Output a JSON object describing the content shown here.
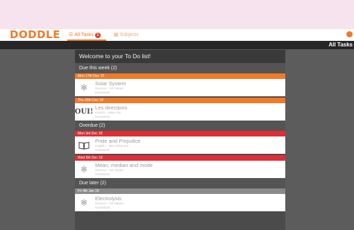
{
  "app": {
    "logo": "DODDLE"
  },
  "nav": {
    "tabs": [
      {
        "label": "All Tasks",
        "badge": "1",
        "icon": "list-icon"
      },
      {
        "label": "Subjects",
        "icon": "grid-icon"
      }
    ]
  },
  "subheader": {
    "title": "All Tasks"
  },
  "panel": {
    "title": "Welcome to your To Do list!"
  },
  "sections": [
    {
      "label": "Due this week (2)",
      "tasks": [
        {
          "date": "Mon 17th Dec 18",
          "color": "orange",
          "icon": "atom-icon",
          "title": "Solar System",
          "subtitle": "Science – Mr Harper",
          "type": "Homework"
        },
        {
          "date": "Thu 20th Dec 18",
          "color": "orange",
          "icon": "oui-icon",
          "icon_text": "OUI!",
          "title": "Les directions",
          "subtitle": "French – Miss Fey",
          "type": "Homework"
        }
      ]
    },
    {
      "label": "Overdue (2)",
      "tasks": [
        {
          "date": "Mon 3rd Dec 18",
          "color": "red",
          "icon": "book-icon",
          "title": "Pride and Prejudice",
          "subtitle": "English – Mrs Osbourne",
          "type": "Homework"
        },
        {
          "date": "Wed 5th Dec 18",
          "color": "red",
          "icon": "atom-icon",
          "title": "Mean, median and mode",
          "subtitle": "Science – Mr Harper",
          "type": "Homework"
        }
      ]
    },
    {
      "label": "Due later (2)",
      "tasks": [
        {
          "date": "Fri 4th Jan 19",
          "color": "grey",
          "icon": "atom-icon",
          "title": "Electrolysis",
          "subtitle": "Science – Mr Harper",
          "type": "Homework"
        }
      ]
    }
  ],
  "colors": {
    "brand": "#f07a2a",
    "overdue": "#e02e36",
    "later": "#8a8a8a"
  }
}
